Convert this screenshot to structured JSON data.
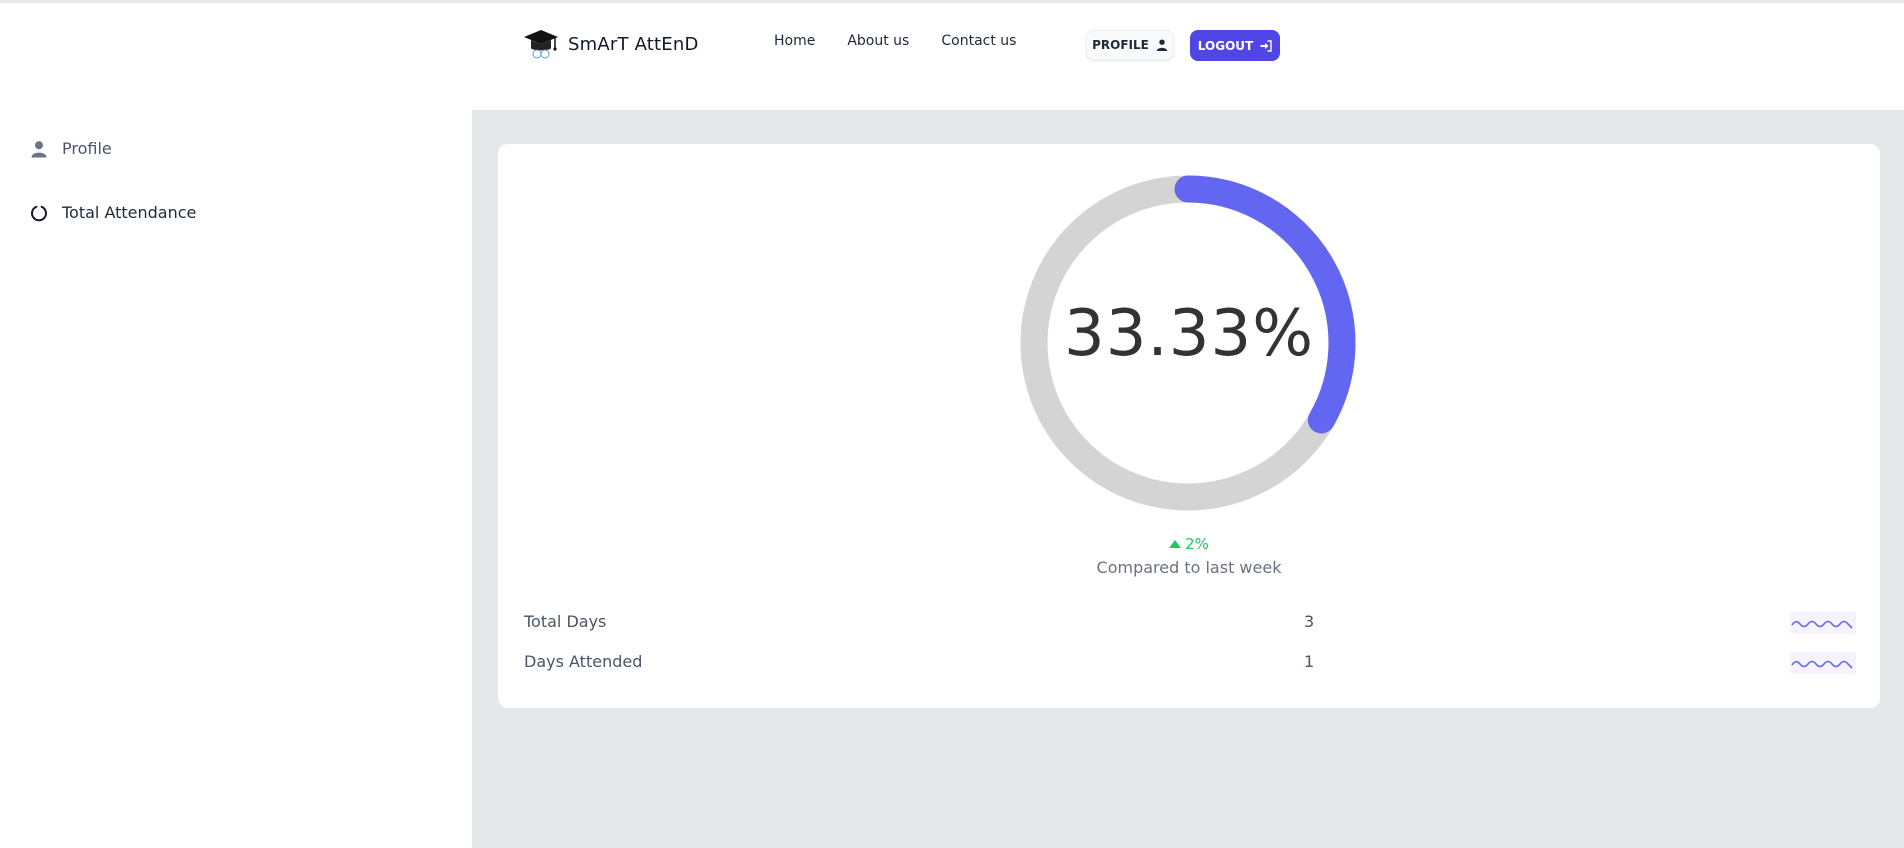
{
  "app": {
    "brand_name": "SmArT AttEnD",
    "logo_icon": "graduation-cap-icon"
  },
  "header": {
    "nav": [
      {
        "label": "Home"
      },
      {
        "label": "About us"
      },
      {
        "label": "Contact us"
      }
    ],
    "profile_button": {
      "label": "PROFILE",
      "icon": "user-icon"
    },
    "logout_button": {
      "label": "LOGOUT",
      "icon": "sign-in-icon"
    }
  },
  "sidebar": {
    "items": [
      {
        "label": "Profile",
        "icon": "user-icon"
      },
      {
        "label": "Total Attendance",
        "icon": "circle-notch-icon"
      }
    ]
  },
  "attendance": {
    "percent_text": "33.33%",
    "percent_value": 0.3333,
    "trend": "2%",
    "trend_direction": "up",
    "compared_text": "Compared to last week",
    "stats": [
      {
        "label": "Total Days",
        "value": "3"
      },
      {
        "label": "Days Attended",
        "value": "1"
      }
    ]
  },
  "colors": {
    "accent": "#6366f1",
    "logout_bg": "#4f46e5",
    "track": "#d4d4d4",
    "trend_up": "#22c55e",
    "main_bg": "#e5e7eb"
  }
}
